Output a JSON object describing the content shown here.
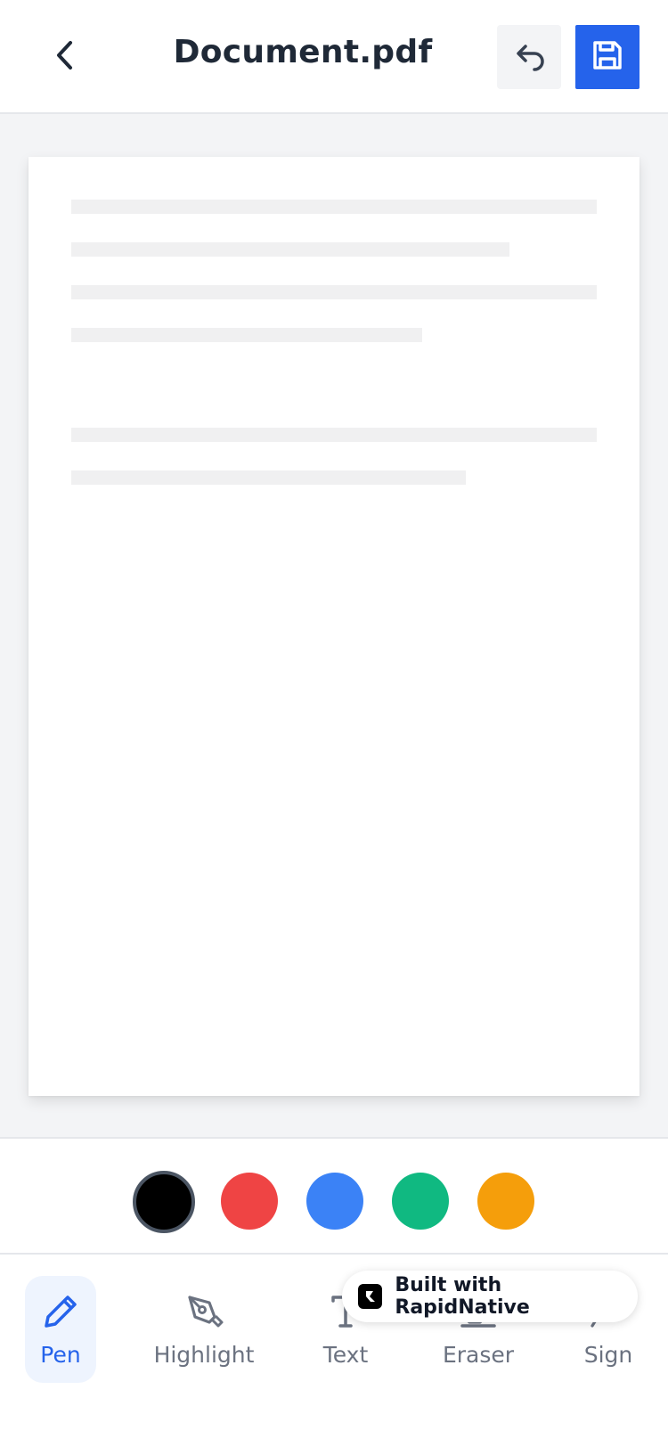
{
  "header": {
    "title": "Document.pdf",
    "back_icon": "chevron-left-icon",
    "undo_icon": "undo-icon",
    "save_icon": "save-icon",
    "accent_color": "#2563eb"
  },
  "palette": {
    "colors": [
      "#000000",
      "#ef4444",
      "#3b82f6",
      "#10b981",
      "#f59e0b"
    ],
    "selected": "#000000"
  },
  "toolbar": {
    "tools": [
      {
        "label": "Pen",
        "icon": "pen-icon",
        "active": true
      },
      {
        "label": "Highlight",
        "icon": "highlight-icon",
        "active": false
      },
      {
        "label": "Text",
        "icon": "text-icon",
        "active": false
      },
      {
        "label": "Eraser",
        "icon": "eraser-icon",
        "active": false
      },
      {
        "label": "Sign",
        "icon": "sign-icon",
        "active": false
      }
    ]
  },
  "badge": {
    "text": "Built with RapidNative"
  }
}
